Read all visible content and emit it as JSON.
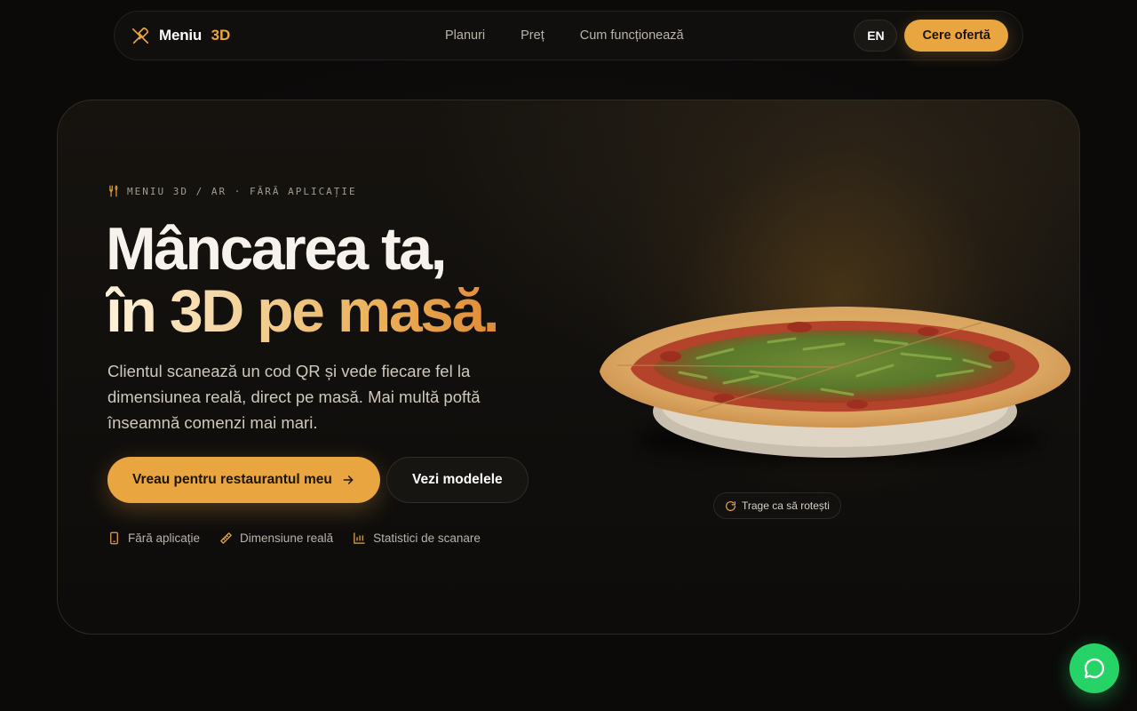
{
  "nav": {
    "brand_name": "Meniu",
    "brand_accent": "3D",
    "links": [
      "Planuri",
      "Preț",
      "Cum funcționează"
    ],
    "lang": "EN",
    "cta": "Cere ofertă"
  },
  "hero": {
    "eyebrow": "MENIU 3D / AR · FĂRĂ APLICAȚIE",
    "headline_line1": "Mâncarea ta,",
    "headline_line2": "în 3D pe masă.",
    "description": "Clientul scanează un cod QR și vede fiecare fel la dimensiunea reală, direct pe masă. Mai multă poftă înseamnă comenzi mai mari.",
    "primary_button": "Vreau pentru restaurantul meu",
    "secondary_button": "Vezi modelele",
    "features": [
      {
        "icon": "phone-icon",
        "label": "Fără aplicație"
      },
      {
        "icon": "ruler-icon",
        "label": "Dimensiune reală"
      },
      {
        "icon": "bar-chart-icon",
        "label": "Statistici de scanare"
      }
    ],
    "rotate_hint": "Trage ca să rotești"
  },
  "colors": {
    "accent": "#e9a53f",
    "background": "#0b0a09",
    "whatsapp": "#25d366"
  }
}
